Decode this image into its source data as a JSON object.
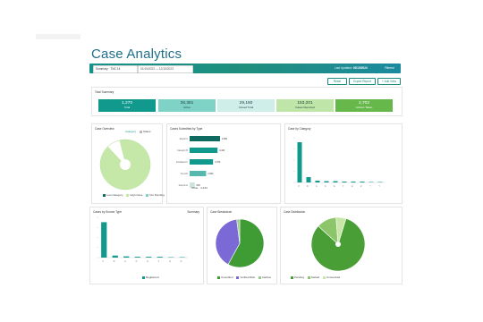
{
  "page_title": "Case Analytics",
  "toolbar": {
    "filter_value": "Summary · TNC 14",
    "date_range": "01/15/2023 — 12/15/2023",
    "last_updated_label": "Last Updated",
    "last_updated_value": "03/15/2024",
    "filtered_label": "Filtered"
  },
  "buttons": {
    "reset": "Reset",
    "export": "Export Report",
    "add": "+ Add View"
  },
  "summary": {
    "title": "Total Summary",
    "cards": [
      {
        "value": "1,270",
        "label": "Total",
        "bg": "#12998e",
        "fg": "#ffffff"
      },
      {
        "value": "36,381",
        "label": "Active",
        "bg": "#7fd3c6",
        "fg": "#21433f"
      },
      {
        "value": "29,160",
        "label": "Closed Total",
        "bg": "#cfeeea",
        "fg": "#21433f"
      },
      {
        "value": "153,201",
        "label": "Cases Reported",
        "bg": "#bfe6a8",
        "fg": "#21433f"
      },
      {
        "value": "2,702",
        "label": "Actions Taken",
        "bg": "#66b84a",
        "fg": "#ffffff"
      }
    ]
  },
  "panels": {
    "case_overview": {
      "title": "Case Overview",
      "legend": [
        "Low Category",
        "High Case",
        "Not Pending"
      ],
      "top_legend": [
        "Category",
        "Status"
      ]
    },
    "cases_by_type": {
      "title": "Cases Submitted by Type",
      "footer": "Other · 4,234"
    },
    "category": {
      "title": "Case by Category"
    },
    "by_source": {
      "title": "Cases by Source Type",
      "right_label": "Summary",
      "legend": "Registered"
    },
    "case_breakdown": {
      "title": "Case Breakdown",
      "legend": [
        "Unverified",
        "Verified Risk",
        "Inactive"
      ]
    },
    "case_distribution": {
      "title": "Case Distribution",
      "legend": [
        "Pending",
        "Settled",
        "Unresolved"
      ]
    }
  },
  "chart_data": [
    {
      "type": "pie",
      "title": "Case Overview",
      "slices": [
        {
          "name": "High Case",
          "value": 92,
          "color": "#c5e8a8"
        },
        {
          "name": "Low Category",
          "value": 8,
          "color": "#ffffff"
        }
      ]
    },
    {
      "type": "bar",
      "title": "Cases Submitted by Type",
      "categories": [
        "Report A",
        "Category B",
        "Escalated C",
        "Trend D",
        "Sample E"
      ],
      "values": [
        4800,
        4400,
        3700,
        2600,
        800
      ],
      "labels": [
        "4,800",
        "4,400",
        "3,700",
        "2,600",
        "800"
      ],
      "colors": [
        "#0f6b5f",
        "#12998e",
        "#12998e",
        "#57b9ae",
        "#cce3e0"
      ]
    },
    {
      "type": "bar",
      "title": "Case by Category",
      "categories": [
        "A",
        "B",
        "C",
        "D",
        "E",
        "F",
        "G",
        "H",
        "I",
        "J"
      ],
      "values": [
        90,
        12,
        4,
        3,
        3,
        2,
        2,
        2,
        1,
        1
      ],
      "ylim": [
        0,
        100
      ],
      "color": "#12998e"
    },
    {
      "type": "bar",
      "title": "Cases by Source Type",
      "categories": [
        "A",
        "B",
        "C",
        "D",
        "E",
        "F",
        "G",
        "H"
      ],
      "values": [
        88,
        5,
        3,
        2,
        2,
        2,
        1,
        1
      ],
      "ylim": [
        0,
        100
      ],
      "color": "#12998e"
    },
    {
      "type": "pie",
      "title": "Case Breakdown",
      "slices": [
        {
          "name": "Unverified",
          "value": 58,
          "color": "#3f9c35"
        },
        {
          "name": "Verified Risk",
          "value": 40,
          "color": "#7b6ad6"
        },
        {
          "name": "Inactive",
          "value": 2,
          "color": "#9cc98a"
        }
      ]
    },
    {
      "type": "pie",
      "title": "Case Distribution",
      "slices": [
        {
          "name": "Pending",
          "value": 82,
          "color": "#4a9e36"
        },
        {
          "name": "Settled",
          "value": 12,
          "color": "#8cc56a"
        },
        {
          "name": "Unresolved",
          "value": 6,
          "color": "#c8e6a6"
        }
      ]
    }
  ]
}
